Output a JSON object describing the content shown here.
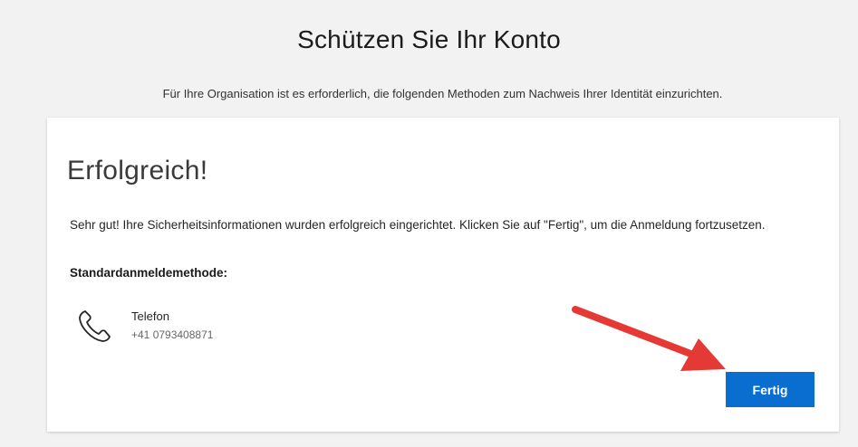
{
  "page": {
    "title": "Schützen Sie Ihr Konto",
    "subtitle": "Für Ihre Organisation ist es erforderlich, die folgenden Methoden zum Nachweis Ihrer Identität einzurichten."
  },
  "card": {
    "heading": "Erfolgreich!",
    "message": "Sehr gut! Ihre Sicherheitsinformationen wurden erfolgreich eingerichtet. Klicken Sie auf \"Fertig\", um die Anmeldung fortzusetzen.",
    "default_method_label": "Standardanmeldemethode:",
    "method": {
      "icon": "phone-icon",
      "name": "Telefon",
      "value": "+41 0793408871"
    },
    "done_label": "Fertig"
  },
  "colors": {
    "accent": "#0a6ed1",
    "annotation_arrow": "#e53935"
  }
}
